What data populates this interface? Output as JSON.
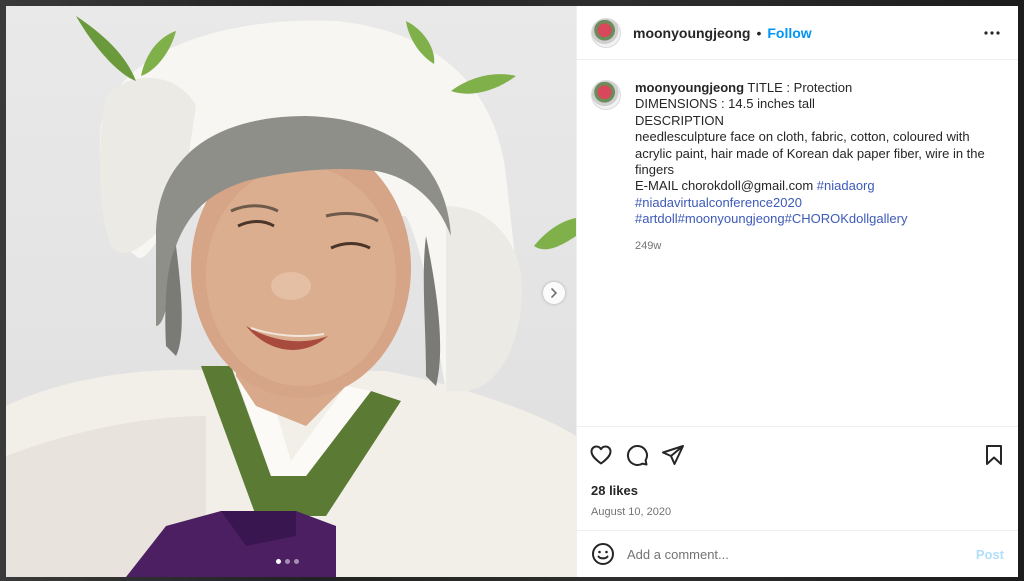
{
  "post": {
    "username": "moonyoungjeong",
    "separator": "•",
    "follow_label": "Follow",
    "more_icon": "more-horizontal-icon"
  },
  "caption": {
    "username": "moonyoungjeong",
    "line1": " TITLE : Protection",
    "line2": "DIMENSIONS : 14.5 inches tall",
    "line3": "DESCRIPTION",
    "line4": "needlesculpture face on cloth, fabric, cotton, coloured with acrylic paint, hair made of Korean dak paper fiber, wire in the fingers",
    "line5": "E-MAIL chorokdoll@gmail.com ",
    "tag1": "#niadaorg",
    "tag2": "#niadavirtualconference2020",
    "tag3": "#artdoll",
    "tag4": "#moonyoungjeong",
    "tag5": "#CHOROKdollgallery",
    "age": "249w"
  },
  "actions": {
    "like_icon": "heart-icon",
    "comment_icon": "comment-icon",
    "share_icon": "send-icon",
    "save_icon": "bookmark-icon"
  },
  "stats": {
    "likes": "28 likes",
    "date": "August 10, 2020"
  },
  "comment_box": {
    "placeholder": "Add a comment...",
    "post_label": "Post"
  },
  "carousel": {
    "slides_total": 3,
    "active_slide": 1
  },
  "colors": {
    "follow": "#0095f6",
    "hashtag": "#3d5ab8",
    "post_disabled": "#b2dffc",
    "text": "#262626",
    "muted": "#737373"
  }
}
